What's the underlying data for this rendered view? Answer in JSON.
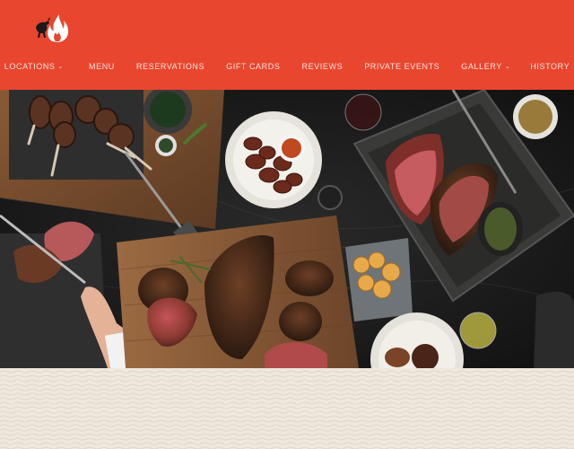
{
  "header": {
    "background_color": "#e8462f",
    "logo_icon": "bull-flame-logo-icon",
    "nav": [
      {
        "label": "LOCATIONS",
        "has_dropdown": true
      },
      {
        "label": "MENU",
        "has_dropdown": false
      },
      {
        "label": "RESERVATIONS",
        "has_dropdown": false
      },
      {
        "label": "GIFT CARDS",
        "has_dropdown": false
      },
      {
        "label": "REVIEWS",
        "has_dropdown": false
      },
      {
        "label": "PRIVATE EVENTS",
        "has_dropdown": false
      },
      {
        "label": "GALLERY",
        "has_dropdown": true
      },
      {
        "label": "HISTORY",
        "has_dropdown": false
      }
    ],
    "dropdown_icon": "chevron-down-icon"
  },
  "hero": {
    "image": "overhead photo of carved meats, lamb chops, sausages, bread rolls and sides on dark marble table"
  },
  "footer_pattern": {
    "color": "#efe8de",
    "line_color": "#e0d6c9"
  }
}
